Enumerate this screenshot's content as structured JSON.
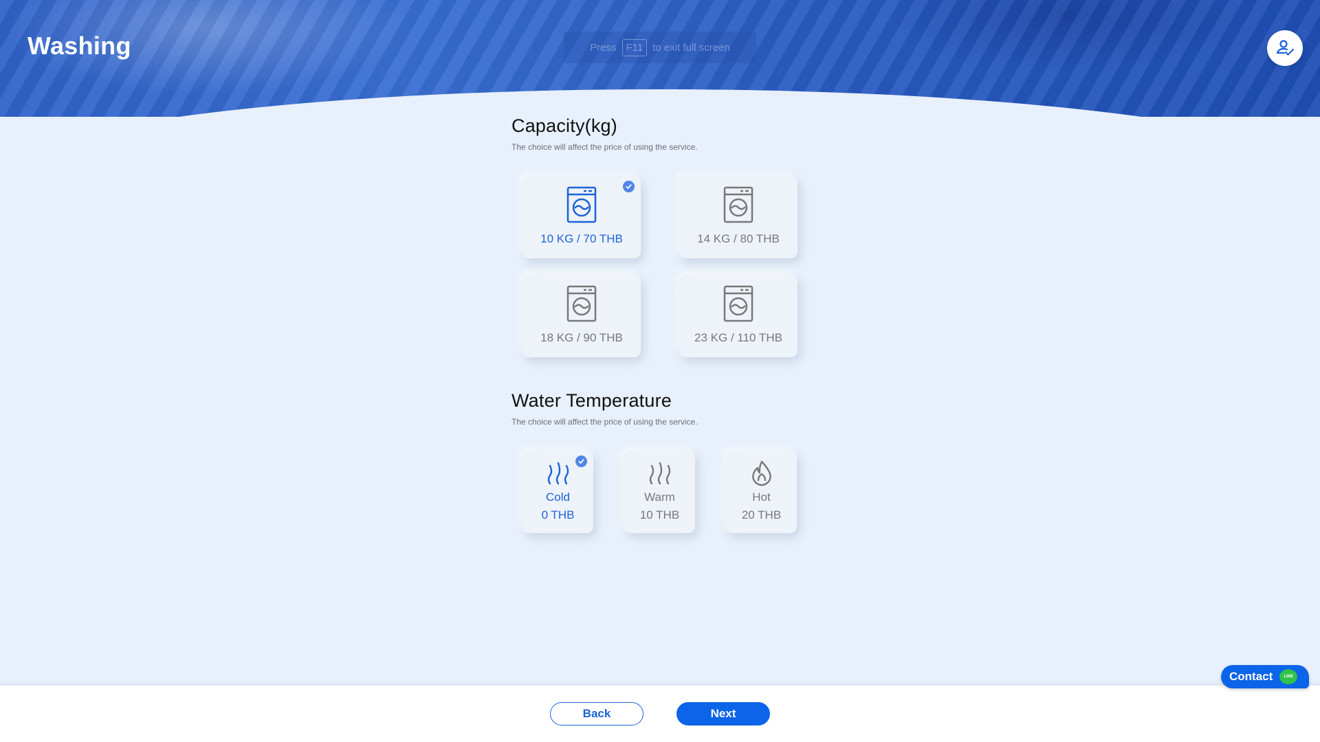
{
  "header": {
    "title": "Washing",
    "fullscreen_hint": {
      "press": "Press",
      "key": "F11",
      "rest": "to exit full screen"
    }
  },
  "capacity": {
    "title": "Capacity(kg)",
    "subtitle": "The choice will affect the price of using the service.",
    "options": [
      {
        "label": "10 KG / 70 THB",
        "selected": true
      },
      {
        "label": "14 KG / 80 THB",
        "selected": false
      },
      {
        "label": "18 KG / 90 THB",
        "selected": false
      },
      {
        "label": "23 KG / 110 THB",
        "selected": false
      }
    ]
  },
  "temperature": {
    "title": "Water Temperature",
    "subtitle": "The choice will affect the price of using the service.",
    "options": [
      {
        "name": "Cold",
        "price": "0 THB",
        "icon": "cold-waves-icon",
        "selected": true
      },
      {
        "name": "Warm",
        "price": "10 THB",
        "icon": "warm-waves-icon",
        "selected": false
      },
      {
        "name": "Hot",
        "price": "20 THB",
        "icon": "flame-icon",
        "selected": false
      }
    ]
  },
  "footer": {
    "back_label": "Back",
    "next_label": "Next"
  },
  "contact": {
    "label": "Contact",
    "badge": "LINE"
  },
  "colors": {
    "accent": "#1a63d6",
    "button": "#0c64e8",
    "check": "#4f86e6",
    "background": "#e8f0fb",
    "line_green": "#2fc24a"
  }
}
